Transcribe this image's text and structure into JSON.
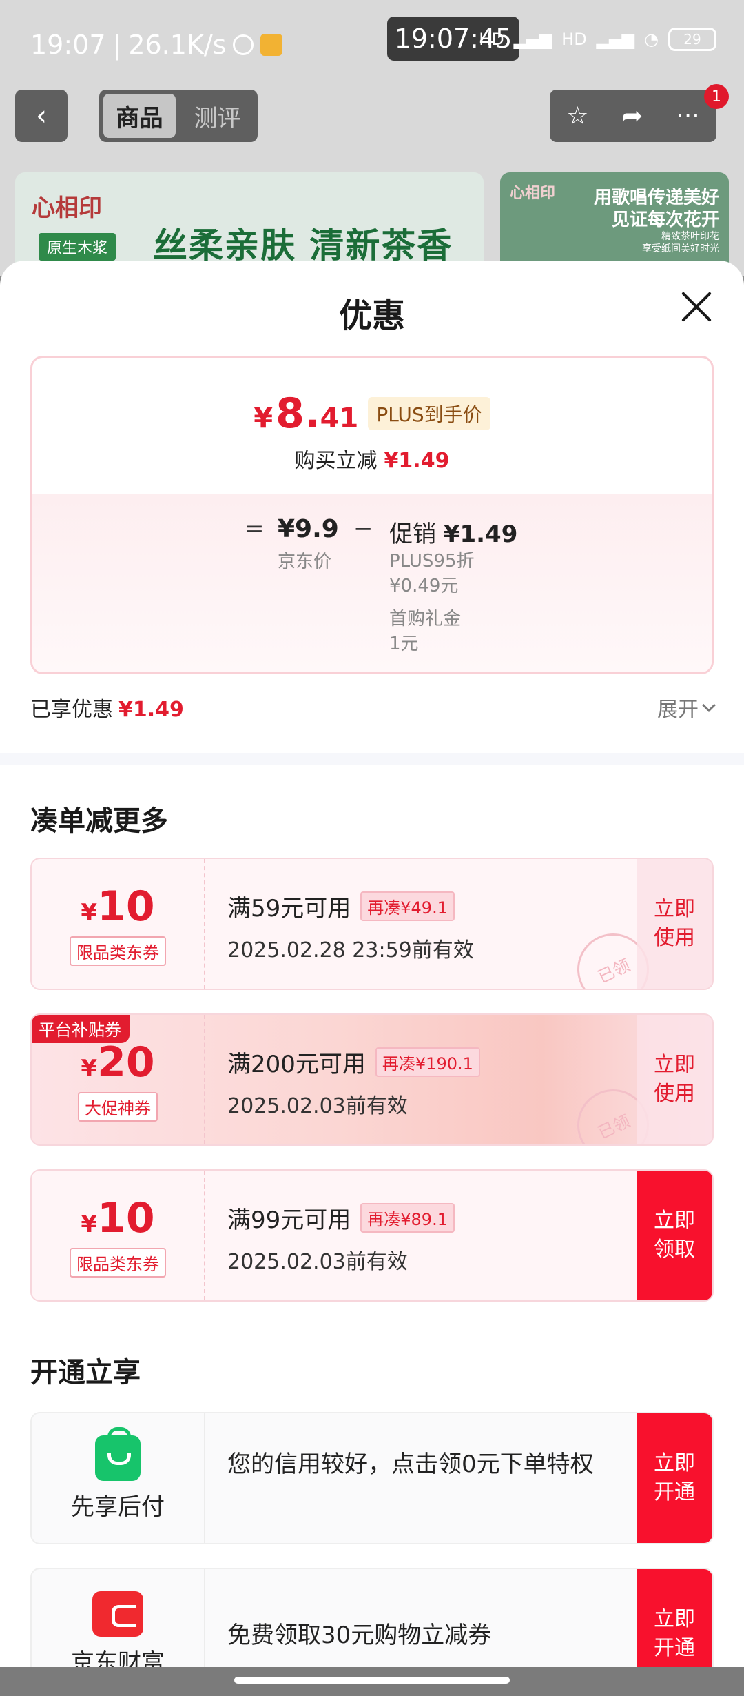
{
  "status_bar": {
    "time": "19:07",
    "speed": "26.1K/s",
    "clock_pill": "19:07:45",
    "network_1": "HD",
    "network_2": "HD",
    "battery": "29"
  },
  "nav": {
    "tabs": [
      "商品",
      "测评"
    ],
    "active_tab": "商品",
    "badge_count": "1"
  },
  "banner": {
    "brand": "心相印",
    "tag": "原生木浆",
    "slogan": "丝柔亲肤 清新茶香",
    "right_line1": "用歌唱传递美好",
    "right_line2": "见证每次花开",
    "right_line3": "精致茶叶印花",
    "right_line4": "享受纸间美好时光",
    "right_brand": "心相印"
  },
  "sheet": {
    "title": "优惠",
    "plus": {
      "yen": "¥",
      "price_int": "8.",
      "price_frac": "41",
      "tag": "PLUS到手价"
    },
    "reduce": {
      "label": "购买立减",
      "value": "¥1.49"
    },
    "calc": {
      "eq": "=",
      "jd_price": "¥9.9",
      "jd_label": "京东价",
      "minus": "−",
      "promo_label": "促销",
      "promo_value": "¥1.49",
      "sub1": "PLUS95折",
      "sub2": "¥0.49元",
      "sub3": "首购礼金",
      "sub4": "1元"
    },
    "enjoyed": {
      "label": "已享优惠",
      "value": "¥1.49"
    },
    "expand_label": "展开"
  },
  "coupons_section": {
    "title": "凑单减更多",
    "coupons": [
      {
        "yen": "¥",
        "amount": "10",
        "type": "限品类东券",
        "condition": "满59元可用",
        "more": "再凑¥49.1",
        "valid": "2025.02.28 23:59前有效",
        "action": "立即使用",
        "stamp": "已领",
        "flag": ""
      },
      {
        "yen": "¥",
        "amount": "20",
        "type": "大促神券",
        "condition": "满200元可用",
        "more": "再凑¥190.1",
        "valid": "2025.02.03前有效",
        "action": "立即使用",
        "stamp": "已领",
        "flag": "平台补贴券"
      },
      {
        "yen": "¥",
        "amount": "10",
        "type": "限品类东券",
        "condition": "满99元可用",
        "more": "再凑¥89.1",
        "valid": "2025.02.03前有效",
        "action": "立即领取",
        "stamp": "",
        "flag": ""
      }
    ]
  },
  "services_section": {
    "title": "开通立享",
    "services": [
      {
        "icon": "shopping-bag-icon",
        "name": "先享后付",
        "desc": "您的信用较好，点击领0元下单特权",
        "action": "立即开通"
      },
      {
        "icon": "wallet-icon",
        "name": "京东财富",
        "desc": "免费领取30元购物立减券",
        "action": "立即开通"
      }
    ]
  },
  "colors": {
    "accent_red": "#e21c2f",
    "button_red": "#f8112d",
    "green": "#17c46b"
  }
}
